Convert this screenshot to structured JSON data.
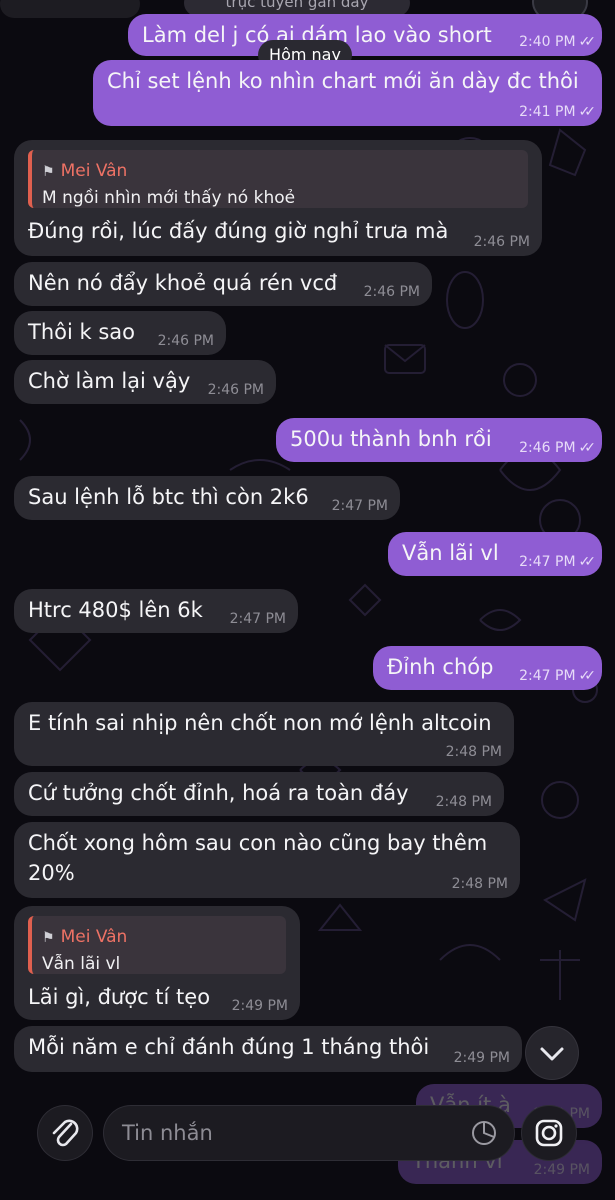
{
  "header": {
    "status_text": "trực tuyến gần đây"
  },
  "date_separator": "Hôm nay",
  "messages": [
    {
      "dir": "out",
      "text": "Làm del j có ai dám lao vào short",
      "time": "2:40 PM",
      "read": true
    },
    {
      "dir": "out",
      "text": "Chỉ set lệnh ko nhìn chart mới ăn dày đc thôi",
      "time": "2:41 PM",
      "read": true
    },
    {
      "dir": "in",
      "reply_author": "Mei Vân",
      "reply_text": "M ngồi nhìn mới thấy nó khoẻ",
      "text": "Đúng rồi, lúc đấy đúng giờ nghỉ trưa mà",
      "time": "2:46 PM"
    },
    {
      "dir": "in",
      "text": "Nên nó đẩy khoẻ quá rén vcđ",
      "time": "2:46 PM"
    },
    {
      "dir": "in",
      "text": "Thôi k sao",
      "time": "2:46 PM"
    },
    {
      "dir": "in",
      "text": "Chờ làm lại vậy",
      "time": "2:46 PM"
    },
    {
      "dir": "out",
      "text": "500u thành bnh rồi",
      "time": "2:46 PM",
      "read": true
    },
    {
      "dir": "in",
      "text": "Sau lệnh lỗ btc thì còn 2k6",
      "time": "2:47 PM"
    },
    {
      "dir": "out",
      "text": "Vẫn lãi vl",
      "time": "2:47 PM",
      "read": true
    },
    {
      "dir": "in",
      "text": "Htrc 480$ lên 6k",
      "time": "2:47 PM"
    },
    {
      "dir": "out",
      "text": "Đỉnh chóp",
      "time": "2:47 PM",
      "read": true
    },
    {
      "dir": "in",
      "text": "E tính sai nhịp nên chốt non mớ lệnh altcoin",
      "time": "2:48 PM"
    },
    {
      "dir": "in",
      "text": "Cứ tưởng chốt đỉnh, hoá ra toàn đáy",
      "time": "2:48 PM"
    },
    {
      "dir": "in",
      "text": "Chốt xong hôm sau con nào cũng bay thêm 20%",
      "time": "2:48 PM"
    },
    {
      "dir": "in",
      "reply_author": "Mei Vân",
      "reply_text": "Vẫn lãi vl",
      "text": "Lãi gì, được tí tẹo",
      "time": "2:49 PM"
    },
    {
      "dir": "in",
      "text": "Mỗi năm e chỉ đánh đúng 1 tháng thôi",
      "time": "2:49 PM"
    },
    {
      "dir": "out",
      "text": "Vẫn ít à",
      "time": "2:49 PM",
      "read": true
    },
    {
      "dir": "out",
      "text": "Thanh vl",
      "time": "2:49 PM",
      "read": true
    }
  ],
  "composer": {
    "placeholder": "Tin nhắn"
  },
  "icons": {
    "attach": "paperclip-icon",
    "sticker": "sticker-icon",
    "camera": "instagram-camera-icon",
    "scroll": "chevron-down-icon",
    "read": "double-check-icon"
  },
  "colors": {
    "outgoing_bubble": "#8f5dd3",
    "incoming_bubble": "#2b2a31",
    "reply_accent": "#e0604f",
    "background": "#0b0a10"
  }
}
